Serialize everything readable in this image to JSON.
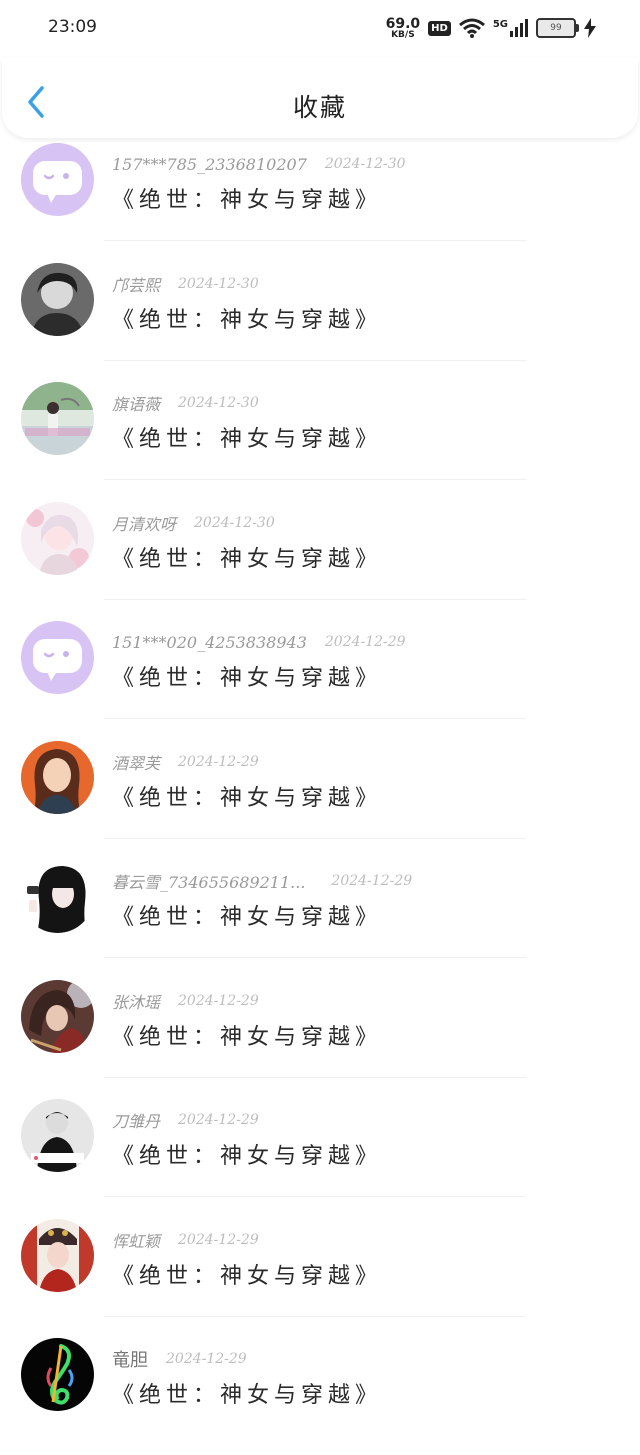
{
  "status_bar": {
    "time": "23:09",
    "speed_value": "69.0",
    "speed_unit": "KB/S",
    "hd": "HD",
    "network": "5G",
    "battery": "99"
  },
  "header": {
    "title": "收藏",
    "back_icon": "chevron-left-icon",
    "accent_color": "#3aa0e8"
  },
  "items": [
    {
      "name": "157***785_2336810207",
      "date": "2024-12-30",
      "title": "《绝世：神女与穿越》",
      "avatar": "chat-bubble-placeholder"
    },
    {
      "name": "邝芸熙",
      "date": "2024-12-30",
      "title": "《绝世：神女与穿越》",
      "avatar": "photo"
    },
    {
      "name": "旗语薇",
      "date": "2024-12-30",
      "title": "《绝世：神女与穿越》",
      "avatar": "photo"
    },
    {
      "name": "月清欢呀",
      "date": "2024-12-30",
      "title": "《绝世：神女与穿越》",
      "avatar": "photo"
    },
    {
      "name": "151***020_4253838943",
      "date": "2024-12-29",
      "title": "《绝世：神女与穿越》",
      "avatar": "chat-bubble-placeholder"
    },
    {
      "name": "酒翠芙",
      "date": "2024-12-29",
      "title": "《绝世：神女与穿越》",
      "avatar": "photo"
    },
    {
      "name": "暮云雪_734655689211...",
      "date": "2024-12-29",
      "title": "《绝世：神女与穿越》",
      "avatar": "photo"
    },
    {
      "name": "张沐瑶",
      "date": "2024-12-29",
      "title": "《绝世：神女与穿越》",
      "avatar": "photo"
    },
    {
      "name": "刀雏丹",
      "date": "2024-12-29",
      "title": "《绝世：神女与穿越》",
      "avatar": "photo"
    },
    {
      "name": "恽虹颖",
      "date": "2024-12-29",
      "title": "《绝世：神女与穿越》",
      "avatar": "photo"
    },
    {
      "name": "竜胆",
      "date": "2024-12-29",
      "title": "《绝世：神女与穿越》",
      "avatar": "photo"
    }
  ]
}
